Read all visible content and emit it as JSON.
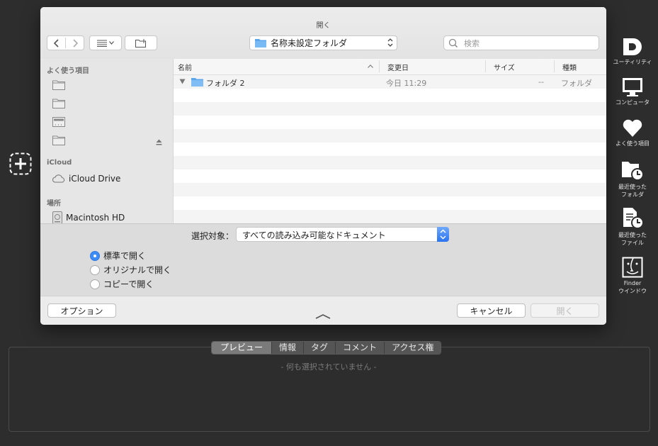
{
  "dialog": {
    "title": "開く",
    "path_label": "名称未設定フォルダ",
    "search_placeholder": "検索"
  },
  "sidebar": {
    "favorites_header": "よく使う項目",
    "icloud_header": "iCloud",
    "icloud_drive": "iCloud Drive",
    "locations_header": "場所",
    "macintosh_hd": "Macintosh HD"
  },
  "list": {
    "columns": {
      "name": "名前",
      "modified": "変更日",
      "size": "サイズ",
      "kind": "種類"
    },
    "rows": [
      {
        "name": "フォルダ 2",
        "modified": "今日 11:29",
        "size": "--",
        "kind": "フォルダ"
      }
    ]
  },
  "options": {
    "enable_label": "選択対象：",
    "enable_value": "すべての読み込み可能なドキュメント",
    "radios": [
      "標準で開く",
      "オリジナルで開く",
      "コピーで開く"
    ],
    "selected_radio": 0
  },
  "footer": {
    "options_button": "オプション",
    "cancel_button": "キャンセル",
    "open_button": "開く"
  },
  "rightbar": {
    "utilities": "ユーティリティ",
    "computer": "コンピュータ",
    "favorites": "よく使う項目",
    "recent_folders_1": "最近使った",
    "recent_folders_2": "フォルダ",
    "recent_files_1": "最近使った",
    "recent_files_2": "ファイル",
    "finder_1": "Finder",
    "finder_2": "ウインドウ"
  },
  "inspector": {
    "tabs": [
      "プレビュー",
      "情報",
      "タグ",
      "コメント",
      "アクセス権"
    ],
    "active_tab": 0,
    "empty_message": "- 何も選択されていません -"
  }
}
